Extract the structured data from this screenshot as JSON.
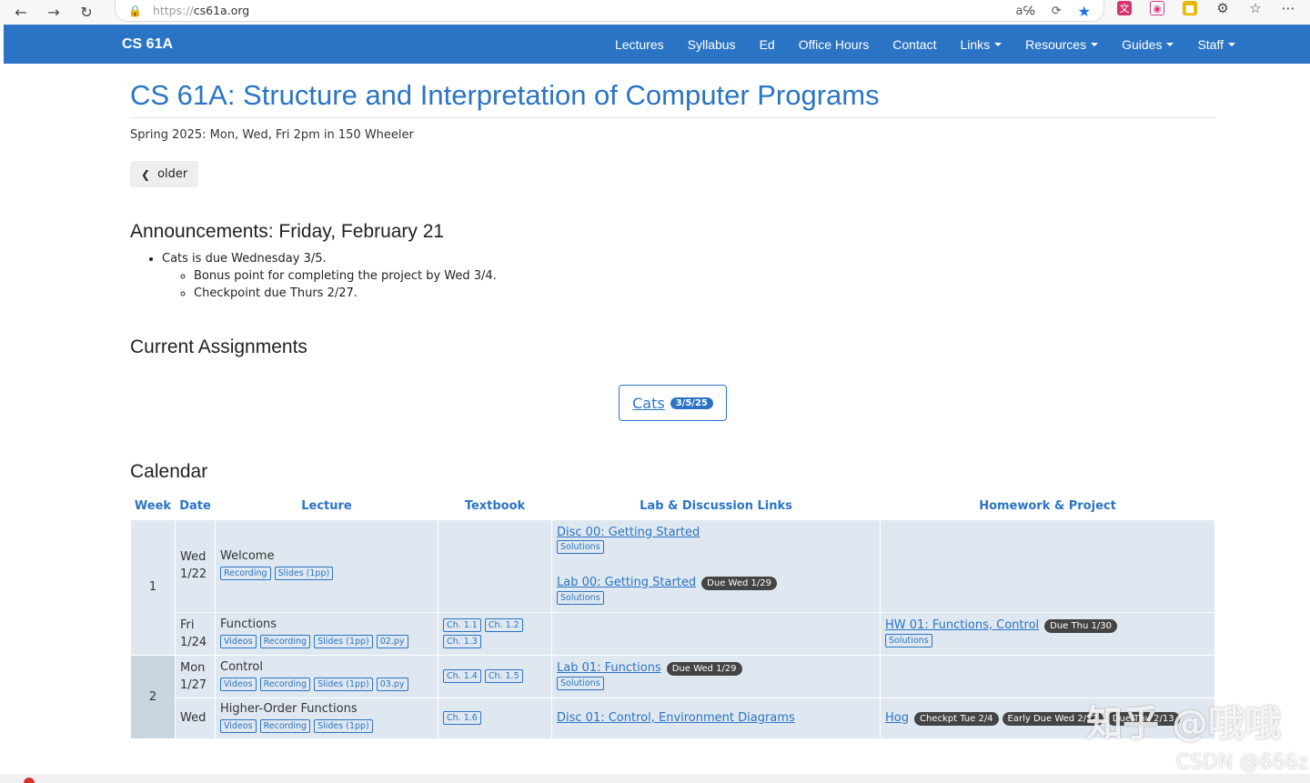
{
  "browser": {
    "url_scheme": "https://",
    "url_host": "cs61a.org"
  },
  "navbar": {
    "brand": "CS 61A",
    "items": [
      {
        "label": "Lectures",
        "dropdown": false
      },
      {
        "label": "Syllabus",
        "dropdown": false
      },
      {
        "label": "Ed",
        "dropdown": false
      },
      {
        "label": "Office Hours",
        "dropdown": false
      },
      {
        "label": "Contact",
        "dropdown": false
      },
      {
        "label": "Links",
        "dropdown": true
      },
      {
        "label": "Resources",
        "dropdown": true
      },
      {
        "label": "Guides",
        "dropdown": true
      },
      {
        "label": "Staff",
        "dropdown": true
      }
    ]
  },
  "page": {
    "title": "CS 61A: Structure and Interpretation of Computer Programs",
    "subtitle": "Spring 2025: Mon, Wed, Fri 2pm in 150 Wheeler",
    "older_label": "older"
  },
  "announcements": {
    "heading": "Announcements: Friday, February 21",
    "item": "Cats is due Wednesday 3/5.",
    "sub_items": [
      "Bonus point for completing the project by Wed 3/4.",
      "Checkpoint due Thurs 2/27."
    ]
  },
  "assignments": {
    "heading": "Current Assignments",
    "name": "Cats",
    "due": "3/5/25"
  },
  "calendar": {
    "heading": "Calendar",
    "columns": [
      "Week",
      "Date",
      "Lecture",
      "Textbook",
      "Lab & Discussion Links",
      "Homework & Project"
    ],
    "rows": [
      {
        "week": "1",
        "day": "Wed",
        "date": "1/22",
        "lecture": "Welcome",
        "lecture_tags": [
          "Recording",
          "Slides (1pp)"
        ],
        "textbook": [],
        "labs": [
          {
            "title": "Disc 00: Getting Started",
            "due": "",
            "tags": [
              "Solutions"
            ]
          },
          {
            "title": "Lab 00: Getting Started",
            "due": "Due Wed 1/29",
            "tags": [
              "Solutions"
            ]
          }
        ],
        "homework": []
      },
      {
        "day": "Fri",
        "date": "1/24",
        "lecture": "Functions",
        "lecture_tags": [
          "Videos",
          "Recording",
          "Slides (1pp)",
          "02.py"
        ],
        "textbook": [
          "Ch. 1.1",
          "Ch. 1.2",
          "Ch. 1.3"
        ],
        "labs": [],
        "homework": [
          {
            "title": "HW 01: Functions, Control",
            "due": [
              "Due Thu 1/30"
            ],
            "tags": [
              "Solutions"
            ]
          }
        ]
      },
      {
        "week": "2",
        "day": "Mon",
        "date": "1/27",
        "lecture": "Control",
        "lecture_tags": [
          "Videos",
          "Recording",
          "Slides (1pp)",
          "03.py"
        ],
        "textbook": [
          "Ch. 1.4",
          "Ch. 1.5"
        ],
        "labs": [
          {
            "title": "Lab 01: Functions",
            "due": "Due Wed 1/29",
            "tags": [
              "Solutions"
            ]
          }
        ],
        "homework": []
      },
      {
        "day": "Wed",
        "date": "",
        "lecture": "Higher-Order Functions",
        "lecture_tags": [
          "Videos",
          "Recording",
          "Slides (1pp)"
        ],
        "textbook": [
          "Ch. 1.6"
        ],
        "labs": [
          {
            "title": "Disc 01: Control, Environment Diagrams",
            "due": "",
            "tags": []
          }
        ],
        "homework": [
          {
            "title": "Hog",
            "due": [
              "Checkpt Tue 2/4",
              "Early Due Wed 2/12",
              "Due Thu 2/13"
            ],
            "tags": []
          }
        ]
      }
    ]
  },
  "watermark": {
    "line1": "知乎 @哦哦",
    "line2": "CSDN @666z"
  }
}
